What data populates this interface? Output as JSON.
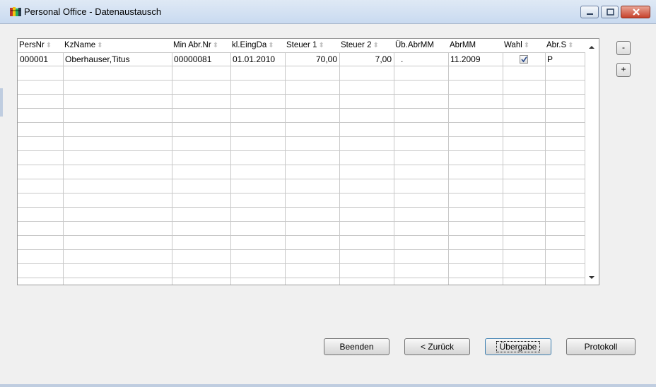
{
  "window": {
    "title": "Personal Office - Datenaustausch",
    "colors": {
      "titlebar": "#c9daf0",
      "close": "#c7422c",
      "body": "#f0f0f0"
    }
  },
  "grid": {
    "columns": [
      {
        "label": "PersNr",
        "sortable": true
      },
      {
        "label": "KzName",
        "sortable": true
      },
      {
        "label": "Min Abr.Nr",
        "sortable": true
      },
      {
        "label": "kl.EingDa",
        "sortable": true
      },
      {
        "label": "Steuer 1",
        "sortable": true
      },
      {
        "label": "Steuer 2",
        "sortable": true
      },
      {
        "label": "Üb.AbrMM",
        "sortable": false
      },
      {
        "label": "AbrMM",
        "sortable": false
      },
      {
        "label": "Wahl",
        "sortable": true
      },
      {
        "label": "Abr.S",
        "sortable": true
      }
    ],
    "rows": [
      {
        "persnr": "000001",
        "kzname": "Oberhauser,Titus",
        "min_abr_nr": "00000081",
        "kl_eingda": "01.01.2010",
        "steuer1": "70,00",
        "steuer2": "7,00",
        "ueb_abrmm": ".",
        "abrmm": "11.2009",
        "wahl": true,
        "abr_s": "P"
      }
    ],
    "sort_icon": "sort-arrows-icon"
  },
  "side_buttons": {
    "minus": "-",
    "plus": "+"
  },
  "buttons": {
    "beenden": "Beenden",
    "zurueck": "< Zurück",
    "uebergabe": "Übergabe",
    "protokoll": "Protokoll"
  }
}
